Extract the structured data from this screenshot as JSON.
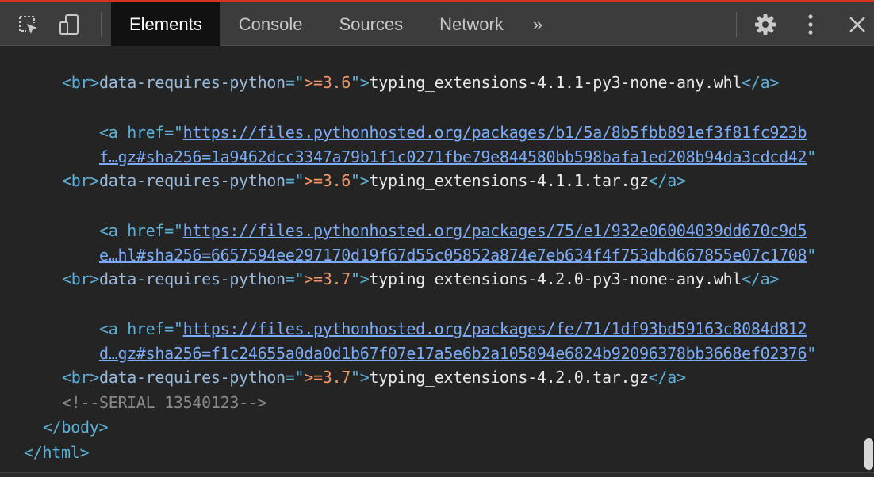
{
  "toolbar": {
    "tabs": [
      {
        "label": "Elements",
        "active": true
      },
      {
        "label": "Console",
        "active": false
      },
      {
        "label": "Sources",
        "active": false
      },
      {
        "label": "Network",
        "active": false
      }
    ],
    "more_tabs_label": "»",
    "icons": [
      "inspect-element-icon",
      "device-toolbar-icon",
      "settings-gear-icon",
      "more-options-icon",
      "close-icon"
    ]
  },
  "dom": {
    "line1": {
      "attr": "data-requires-python",
      "eq": "=\"",
      "val": ">=3.6",
      "close": "\">",
      "text": "typing_extensions-4.1.1-py3-none-any.whl",
      "end": "</a>"
    },
    "br1": "<br>",
    "a2": {
      "open": "<a href=\"",
      "href_part1": "https://files.pythonhosted.org/packages/b1/5a/8b5fbb891ef3f81fc923b",
      "href_part2": "f…gz#sha256=1a9462dcc3347a79b1f1c0271fbe79e844580bb598bafa1ed208b94da3cdcd42",
      "quote": "\"",
      "attr": "data-requires-python",
      "eq": "=\"",
      "val": ">=3.6",
      "close": "\">",
      "text": "typing_extensions-4.1.1.tar.gz",
      "end": "</a>"
    },
    "br2": "<br>",
    "a3": {
      "open": "<a href=\"",
      "href_part1": "https://files.pythonhosted.org/packages/75/e1/932e06004039dd670c9d5",
      "href_part2": "e…hl#sha256=6657594ee297170d19f67d55c05852a874e7eb634f4f753dbd667855e07c1708",
      "quote": "\"",
      "attr": "data-requires-python",
      "eq": "=\"",
      "val": ">=3.7",
      "close": "\">",
      "text": "typing_extensions-4.2.0-py3-none-any.whl",
      "end": "</a>"
    },
    "br3": "<br>",
    "a4": {
      "open": "<a href=\"",
      "href_part1": "https://files.pythonhosted.org/packages/fe/71/1df93bd59163c8084d812",
      "href_part2": "d…gz#sha256=f1c24655a0da0d1b67f07e17a5e6b2a105894e6824b92096378bb3668ef02376",
      "quote": "\"",
      "attr": "data-requires-python",
      "eq": "=\"",
      "val": ">=3.7",
      "close": "\">",
      "text": "typing_extensions-4.2.0.tar.gz",
      "end": "</a>"
    },
    "br4": "<br>",
    "comment": "<!--SERIAL 13540123-->",
    "body_close": "</body>",
    "html_close": "</html>"
  },
  "colors": {
    "tag": "#5db0d7",
    "attribute": "#9bbbdc",
    "attribute_value": "#f29766",
    "link": "#7cacf8",
    "text": "#e8e8e8",
    "comment": "#898989",
    "toolbar_bg": "#3c3c3c",
    "panel_bg": "#242424",
    "accent_top": "#d93025"
  }
}
